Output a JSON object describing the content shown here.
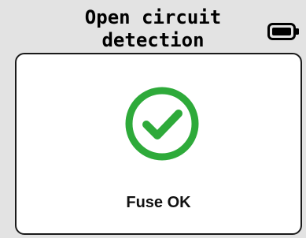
{
  "header": {
    "title": "Open circuit\ndetection",
    "battery_icon": "battery-full-icon"
  },
  "dialog": {
    "status_icon": "checkmark-circle-icon",
    "status_text": "Fuse OK"
  },
  "colors": {
    "background": "#e3e3e3",
    "card": "#ffffff",
    "success": "#2eaa3a",
    "text": "#111111"
  }
}
